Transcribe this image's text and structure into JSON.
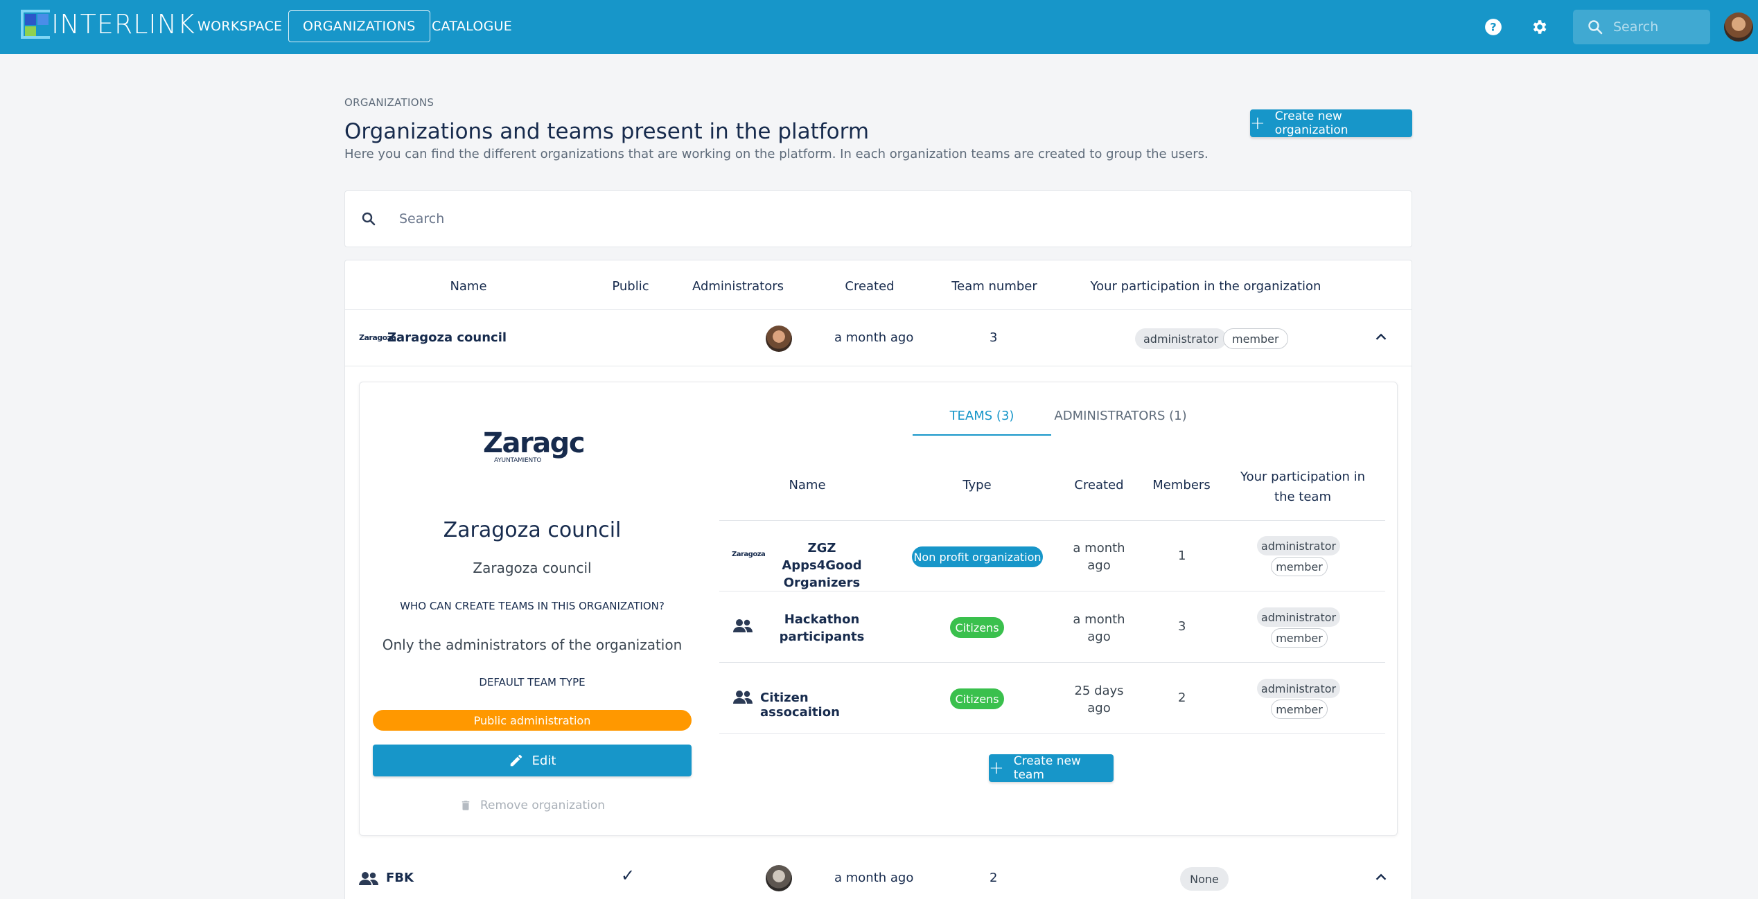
{
  "topbar": {
    "brand": "INTERLINK",
    "nav": [
      "WORKSPACE",
      "ORGANIZATIONS",
      "CATALOGUE"
    ],
    "active_nav": "ORGANIZATIONS",
    "search_placeholder": "Search",
    "icons": [
      "help-icon",
      "settings-icon",
      "search-icon"
    ],
    "color": "#1796c9"
  },
  "header": {
    "breadcrumb": "ORGANIZATIONS",
    "title": "Organizations and teams present in the platform",
    "subtitle": "Here you can find the different organizations that are working on the platform. In each organization teams are created to group the users.",
    "create_button": "Create new organization"
  },
  "search": {
    "placeholder": "Search"
  },
  "table": {
    "columns": [
      "Name",
      "Public",
      "Administrators",
      "Created",
      "Team number",
      "Your participation in the organization"
    ],
    "rows": [
      {
        "logo_text": "Zaragoza",
        "name": "Zaragoza council",
        "public": "",
        "created": "a month ago",
        "team_number": "3",
        "participation": [
          "administrator",
          "member"
        ],
        "expanded": true
      },
      {
        "name": "FBK",
        "public": "✓",
        "created": "a month ago",
        "team_number": "2",
        "participation": [
          "None"
        ],
        "expanded": false
      }
    ]
  },
  "detail": {
    "logo_main": "Zaragc",
    "logo_sub": "AYUNTAMIENTO",
    "name": "Zaragoza council",
    "description": "Zaragoza council",
    "who_can_label": "WHO CAN CREATE TEAMS IN THIS ORGANIZATION?",
    "who_can_value": "Only the administrators of the organization",
    "default_type_label": "DEFAULT TEAM TYPE",
    "default_type_value": "Public administration",
    "edit_button": "Edit",
    "remove_button": "Remove organization",
    "tabs": [
      "TEAMS (3)",
      "ADMINISTRATORS (1)"
    ],
    "active_tab": "TEAMS (3)",
    "team_columns": [
      "Name",
      "Type",
      "Created",
      "Members",
      "Your participation in the team"
    ],
    "teams": [
      {
        "name": "ZGZ Apps4Good Organizers",
        "type": "Non profit organization",
        "type_color": "#1796c9",
        "created": "a month ago",
        "members": "1",
        "participation": [
          "administrator",
          "member"
        ]
      },
      {
        "name": "Hackathon participants",
        "type": "Citizens",
        "type_color": "#3ac04d",
        "created": "a month ago",
        "members": "3",
        "participation": [
          "administrator",
          "member"
        ]
      },
      {
        "name": "Citizen assocaition",
        "type": "Citizens",
        "type_color": "#3ac04d",
        "created": "25 days ago",
        "members": "2",
        "participation": [
          "administrator",
          "member"
        ]
      }
    ],
    "create_team_button": "Create new team",
    "accent_orange": "#ff9800"
  }
}
